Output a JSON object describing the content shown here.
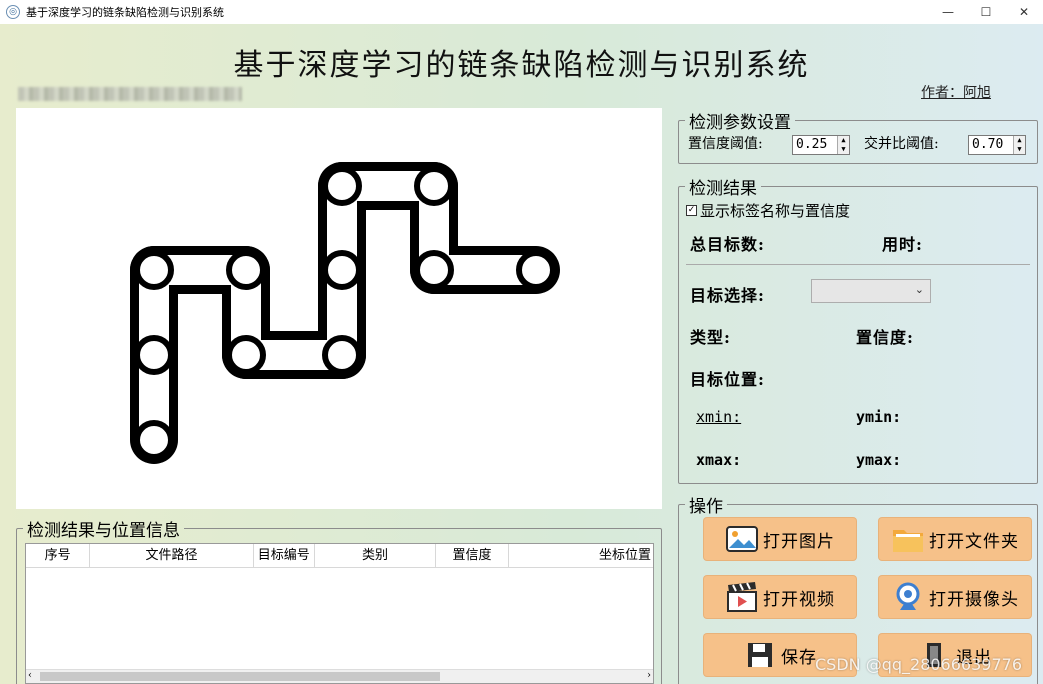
{
  "window": {
    "title": "基于深度学习的链条缺陷检测与识别系统",
    "minimize": "—",
    "maximize": "☐",
    "close": "✕"
  },
  "header": {
    "title": "基于深度学习的链条缺陷检测与识别系统",
    "author": "作者：阿旭"
  },
  "params": {
    "legend": "检测参数设置",
    "conf_label": "置信度阈值:",
    "conf_value": "0.25",
    "iou_label": "交并比阈值:",
    "iou_value": "0.70"
  },
  "results": {
    "legend": "检测结果",
    "show_labels": "显示标签名称与置信度",
    "total_targets": "总目标数:",
    "time_used": "用时:",
    "target_select": "目标选择:",
    "type": "类型:",
    "confidence": "置信度:",
    "position": "目标位置:",
    "xmin": "xmin:",
    "ymin": "ymin:",
    "xmax": "xmax:",
    "ymax": "ymax:"
  },
  "actions": {
    "legend": "操作",
    "open_image": "打开图片",
    "open_folder": "打开文件夹",
    "open_video": "打开视频",
    "open_camera": "打开摄像头",
    "save": "保存",
    "exit": "退出"
  },
  "table": {
    "legend": "检测结果与位置信息",
    "columns": [
      "序号",
      "文件路径",
      "目标编号",
      "类别",
      "置信度",
      "坐标位置"
    ]
  },
  "watermark": "CSDN @qq_28066639776"
}
